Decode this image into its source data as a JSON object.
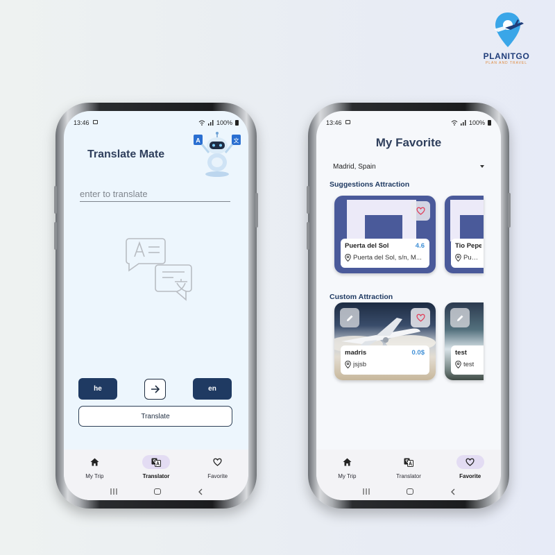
{
  "brand": {
    "name": "PLANITGO",
    "tagline": "PLAN AND TRAVEL",
    "colors": {
      "blue": "#3aa6e8",
      "navy": "#1f3d7a",
      "orange": "#e08a3c"
    }
  },
  "status_bar": {
    "time": "13:46",
    "battery": "100%"
  },
  "translator_screen": {
    "title": "Translate Mate",
    "input": {
      "placeholder": "enter to translate",
      "value": ""
    },
    "source_lang": "he",
    "target_lang": "en",
    "translate_label": "Translate",
    "robot_badge_left": "A",
    "robot_badge_right": "文"
  },
  "favorite_screen": {
    "title": "My Favorite",
    "city": "Madrid, Spain",
    "suggestions_title": "Suggestions Attraction",
    "suggestions": [
      {
        "name": "Puerta del Sol",
        "score": "4.6",
        "address": "Puerta del Sol, s/n, M..."
      },
      {
        "name": "Tio Pepe",
        "address": "Puerta"
      }
    ],
    "custom_title": "Custom Attraction",
    "custom": [
      {
        "name": "madris",
        "price": "0.0$",
        "address": "jsjsb"
      },
      {
        "name": "test",
        "address": "test"
      }
    ]
  },
  "nav_left": {
    "items": [
      {
        "label": "My Trip",
        "icon": "home-icon"
      },
      {
        "label": "Translator",
        "icon": "translate-icon",
        "active": true
      },
      {
        "label": "Favorite",
        "icon": "heart-icon"
      }
    ]
  },
  "nav_right": {
    "items": [
      {
        "label": "My Trip",
        "icon": "home-icon"
      },
      {
        "label": "Translator",
        "icon": "translate-icon"
      },
      {
        "label": "Favorite",
        "icon": "heart-icon",
        "active": true
      }
    ]
  },
  "colors": {
    "primary": "#1f3a62",
    "accent": "#3f8fd6",
    "heart": "#e0405a",
    "active_pill": "#e3dcf3"
  }
}
